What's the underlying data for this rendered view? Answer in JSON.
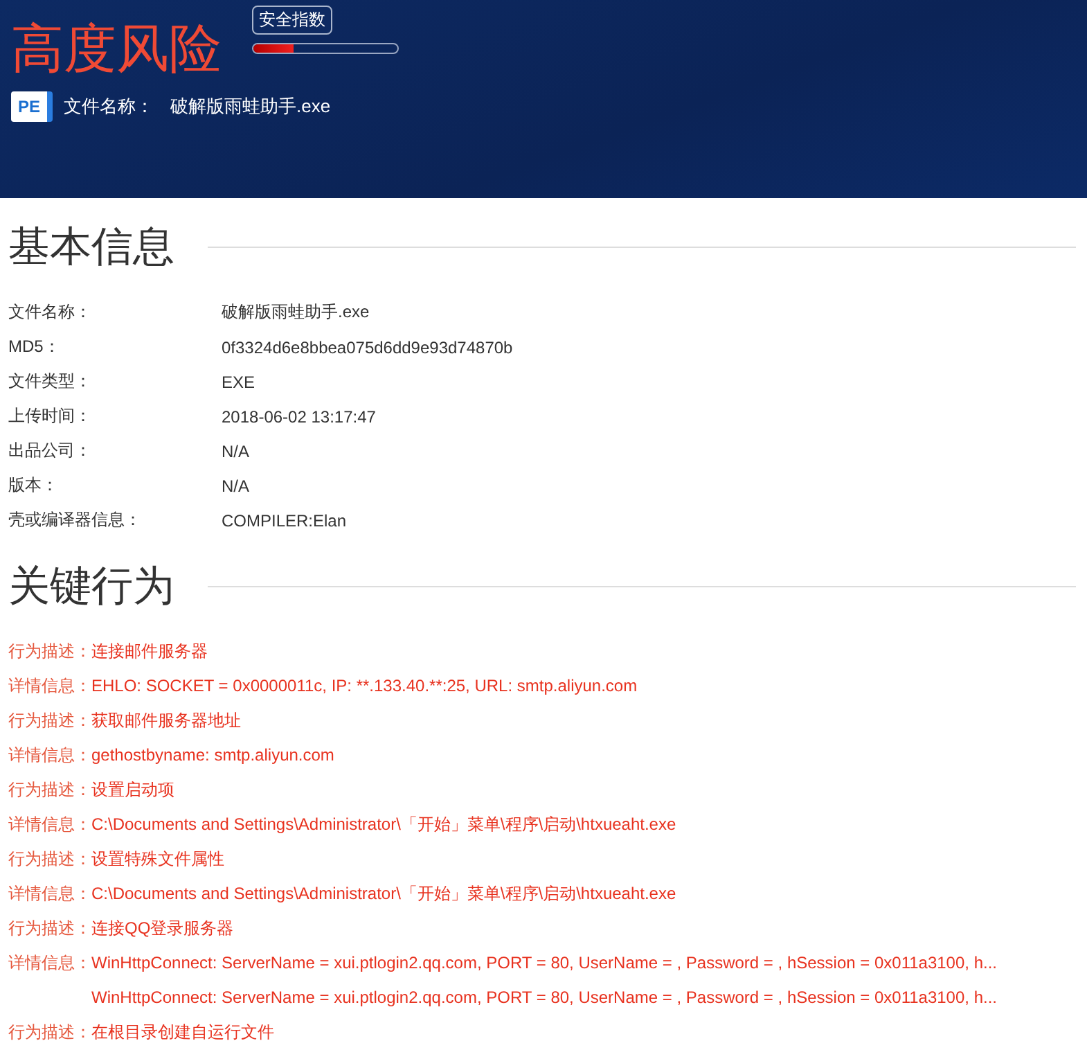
{
  "header": {
    "risk_title": "高度风险",
    "safety_index": {
      "label": "安全指数",
      "level": 0.28
    },
    "file": {
      "icon_text": "PE",
      "label": "文件名称：",
      "value": "破解版雨蛙助手.exe"
    }
  },
  "basic_info": {
    "heading": "基本信息",
    "rows": [
      {
        "label": "文件名称：",
        "value": "破解版雨蛙助手.exe"
      },
      {
        "label": "MD5：",
        "value": "0f3324d6e8bbea075d6dd9e93d74870b"
      },
      {
        "label": "文件类型：",
        "value": "EXE"
      },
      {
        "label": "上传时间：",
        "value": "2018-06-02 13:17:47"
      },
      {
        "label": "出品公司：",
        "value": "N/A"
      },
      {
        "label": "版本：",
        "value": "N/A"
      },
      {
        "label": "壳或编译器信息：",
        "value": "COMPILER:Elan"
      }
    ]
  },
  "key_behaviors": {
    "heading": "关键行为",
    "entries": [
      {
        "label": "行为描述：",
        "values": [
          "连接邮件服务器"
        ]
      },
      {
        "label": "详情信息：",
        "values": [
          "EHLO: SOCKET = 0x0000011c, IP: **.133.40.**:25, URL: smtp.aliyun.com"
        ]
      },
      {
        "label": "行为描述：",
        "values": [
          "获取邮件服务器地址"
        ]
      },
      {
        "label": "详情信息：",
        "values": [
          "gethostbyname: smtp.aliyun.com"
        ]
      },
      {
        "label": "行为描述：",
        "values": [
          "设置启动项"
        ]
      },
      {
        "label": "详情信息：",
        "values": [
          "C:\\Documents and Settings\\Administrator\\「开始」菜单\\程序\\启动\\htxueaht.exe"
        ]
      },
      {
        "label": "行为描述：",
        "values": [
          "设置特殊文件属性"
        ]
      },
      {
        "label": "详情信息：",
        "values": [
          "C:\\Documents and Settings\\Administrator\\「开始」菜单\\程序\\启动\\htxueaht.exe"
        ]
      },
      {
        "label": "行为描述：",
        "values": [
          "连接QQ登录服务器"
        ]
      },
      {
        "label": "详情信息：",
        "values": [
          "WinHttpConnect: ServerName = xui.ptlogin2.qq.com, PORT = 80, UserName = , Password = , hSession = 0x011a3100, h...",
          "WinHttpConnect: ServerName = xui.ptlogin2.qq.com, PORT = 80, UserName = , Password = , hSession = 0x011a3100, h..."
        ]
      },
      {
        "label": "行为描述：",
        "values": [
          "在根目录创建自运行文件"
        ]
      }
    ]
  }
}
